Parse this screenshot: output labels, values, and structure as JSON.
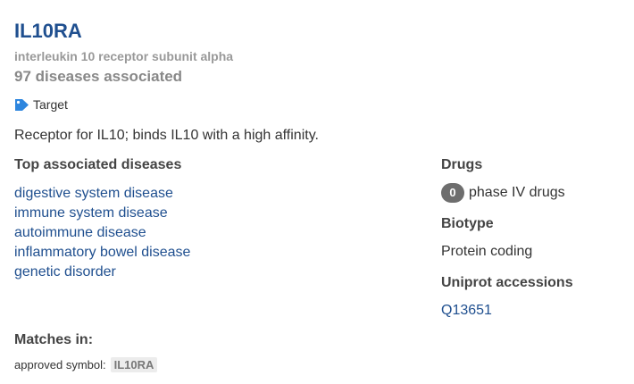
{
  "gene": {
    "symbol": "IL10RA",
    "full_name": "interleukin 10 receptor subunit alpha",
    "disease_count_text": "97 diseases associated",
    "type_label": "Target",
    "type_icon": "tag-icon",
    "description": "Receptor for IL10; binds IL10 with a high affinity."
  },
  "top_diseases": {
    "heading": "Top associated diseases",
    "items": [
      "digestive system disease",
      "immune system disease",
      "autoimmune disease",
      "inflammatory bowel disease",
      "genetic disorder"
    ]
  },
  "drugs": {
    "heading": "Drugs",
    "count": "0",
    "label": "phase IV drugs"
  },
  "biotype": {
    "heading": "Biotype",
    "value": "Protein coding"
  },
  "uniprot": {
    "heading": "Uniprot accessions",
    "accessions": [
      "Q13651"
    ]
  },
  "matches": {
    "heading": "Matches in:",
    "field_label": "approved symbol:",
    "matched_value": "IL10RA"
  },
  "colors": {
    "link": "#1f4f8f",
    "tag_icon": "#2e86de",
    "badge": "#6e6e6e"
  }
}
